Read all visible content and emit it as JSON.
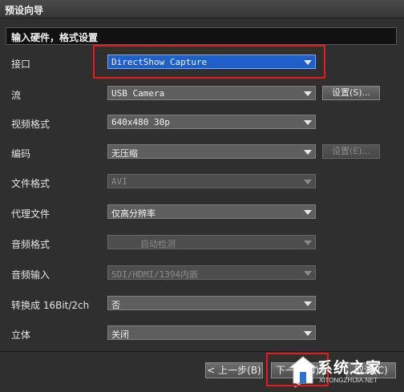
{
  "window": {
    "title": "预设向导"
  },
  "section": {
    "title": "输入硬件，格式设置"
  },
  "rows": [
    {
      "label": "接口",
      "value": "DirectShow Capture"
    },
    {
      "label": "流",
      "value": "USB Camera",
      "button": "设置(S)..."
    },
    {
      "label": "视频格式",
      "value": "640x480 30p"
    },
    {
      "label": "编码",
      "value": "无压缩",
      "button": "设置(E)..."
    },
    {
      "label": "文件格式",
      "value": "AVI"
    },
    {
      "label": "代理文件",
      "value": "仅高分辨率"
    },
    {
      "label": "音频格式",
      "value": "自动检测"
    },
    {
      "label": "音频输入",
      "value": "SDI/HDMI/1394内嵌"
    },
    {
      "label": "转换成 16Bit/2ch",
      "value": "否"
    },
    {
      "label": "立体",
      "value": "关闭"
    }
  ],
  "footer": {
    "back": "< 上一步(B)",
    "next": "下一步(N) >",
    "cancel": "取消(C)"
  },
  "watermark": {
    "text": "系统之家",
    "url": "XITONGZHIJIA.NET"
  },
  "colors": {
    "highlight": "#e11d1d",
    "selected": "#1f5fc9"
  }
}
